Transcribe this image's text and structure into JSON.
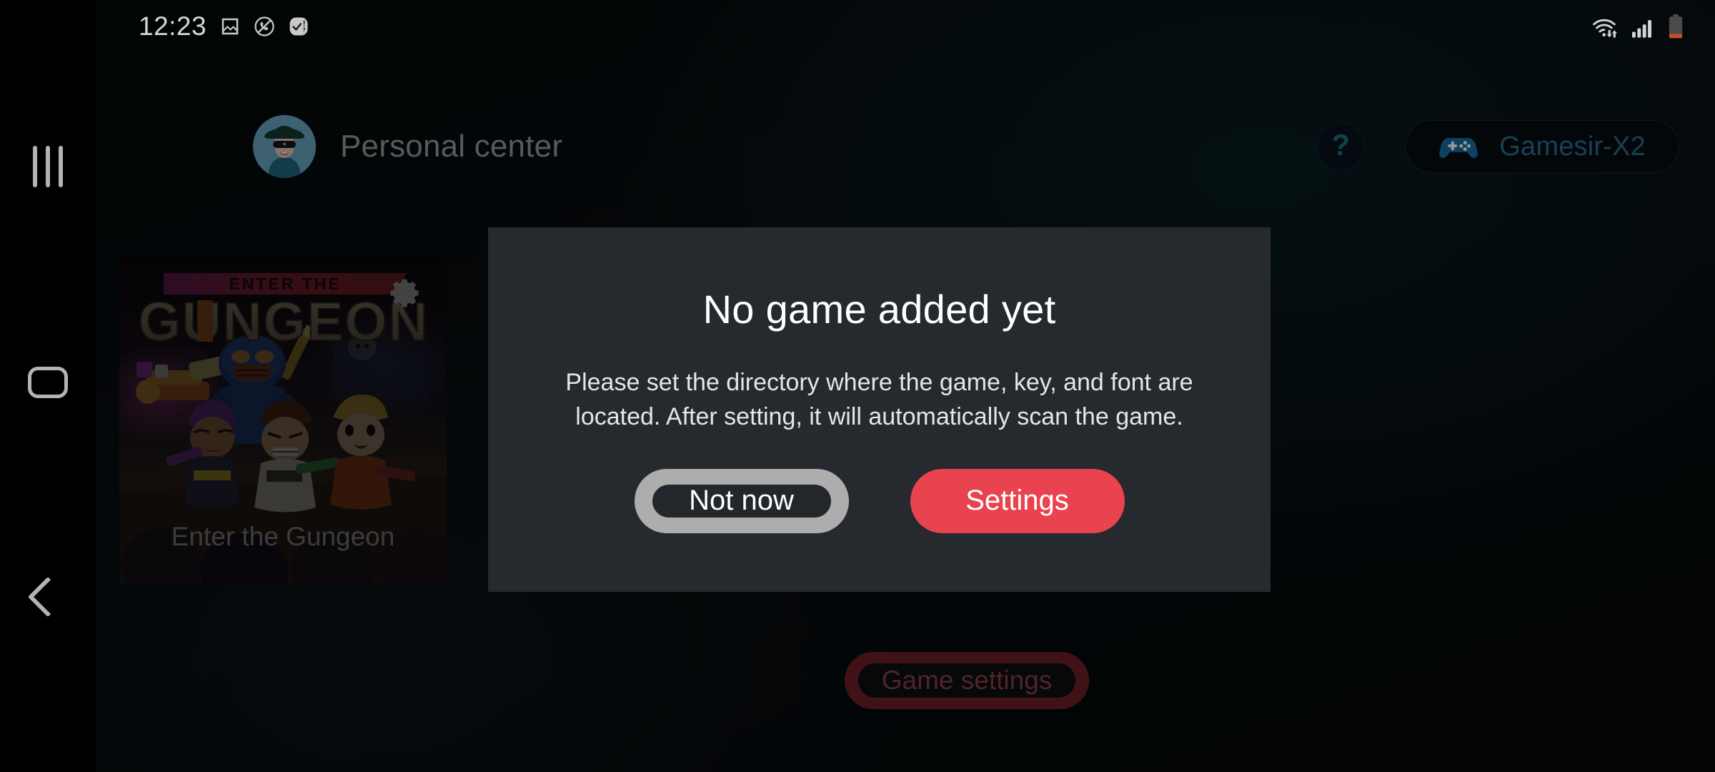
{
  "status_bar": {
    "clock": "12:23",
    "left_icons": [
      {
        "name": "image-icon",
        "glyph": "image"
      },
      {
        "name": "call-blocked-icon",
        "glyph": "call-blocked"
      },
      {
        "name": "alert-check-icon",
        "glyph": "check-alert"
      }
    ],
    "right_icons": [
      {
        "name": "wifi-icon",
        "glyph": "wifi-data"
      },
      {
        "name": "cellular-signal-icon",
        "glyph": "signal-bars"
      },
      {
        "name": "battery-icon",
        "glyph": "battery-low"
      }
    ],
    "battery_level_percent": 18,
    "signal_bars": 4
  },
  "nav_rail": {
    "recents_label": "Recents",
    "home_label": "Home",
    "back_label": "Back"
  },
  "header": {
    "title": "Personal center",
    "avatar_name": "user-avatar",
    "help_label": "?",
    "device": {
      "label": "Gamesir-X2",
      "icon": "gamepad-icon",
      "accent": "#2d6d92"
    }
  },
  "game_card": {
    "title": "Enter the Gungeon",
    "logo_line1": "ENTER THE",
    "logo_line2": "GUNGEON",
    "settings_icon": "gear-icon"
  },
  "game_settings_button": {
    "label": "Game settings"
  },
  "dialog": {
    "title": "No game added yet",
    "message": "Please set the directory where the game, key, and font are located. After setting, it will automatically scan the game.",
    "buttons": {
      "secondary": "Not now",
      "primary": "Settings"
    }
  },
  "colors": {
    "accent_red": "#e8434f",
    "dialog_bg": "#262a2f",
    "teal": "#1d7287",
    "device_blue": "#2d6d92",
    "battery_orange": "#c4502a"
  }
}
